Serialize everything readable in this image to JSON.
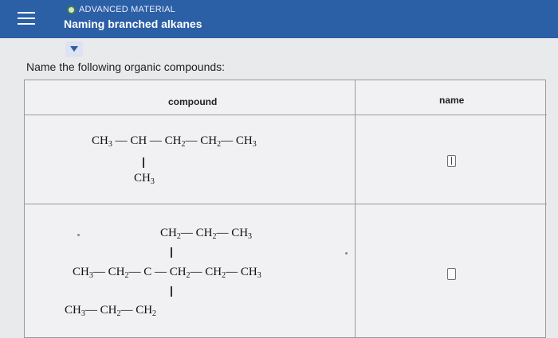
{
  "header": {
    "section_label": "ADVANCED MATERIAL",
    "title": "Naming branched alkanes"
  },
  "instruction": "Name the following organic compounds:",
  "table": {
    "col_compound": "compound",
    "col_name": "name"
  },
  "compound1": {
    "main_chain": [
      "CH",
      "3",
      " — CH — CH",
      "2",
      "— CH",
      "2",
      "— CH",
      "3"
    ],
    "branch": "CH",
    "branch_sub": "3"
  },
  "compound2": {
    "top_chain": "CH",
    "main_left": "CH",
    "bottom_chain": "CH"
  },
  "colors": {
    "header": "#2b5fa6",
    "background": "#e9eaec",
    "table": "#f1f1f3"
  }
}
